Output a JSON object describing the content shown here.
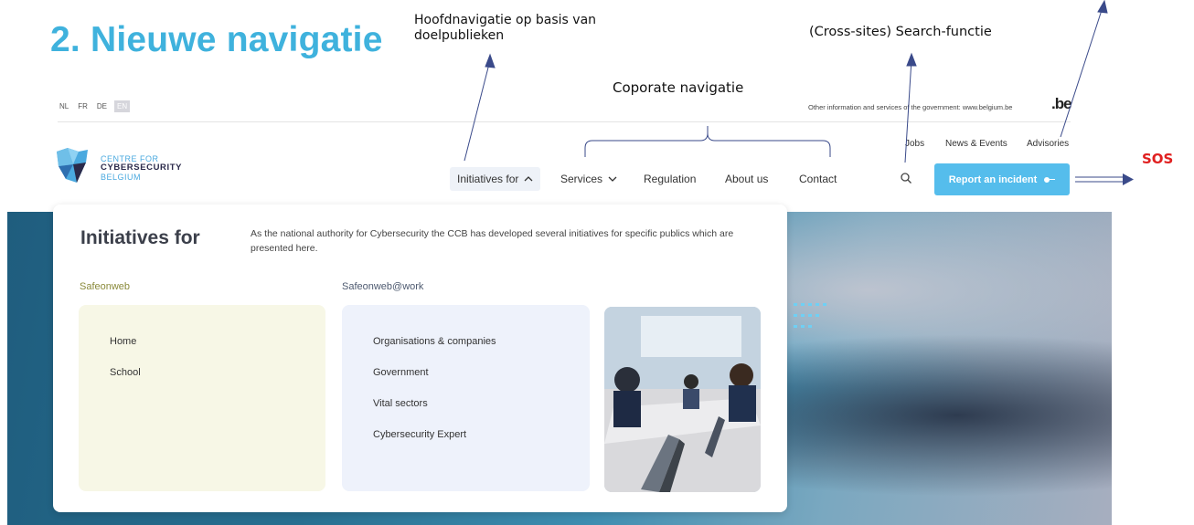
{
  "slide": {
    "title": "2. Nieuwe navigatie",
    "annotations": {
      "hoofdnavigatie": "Hoofdnavigatie op basis van doelpublieken",
      "corporate": "Coporate navigatie",
      "search": "(Cross-sites) Search-functie",
      "sos": "SOS"
    },
    "colors": {
      "title": "#3fb2dd",
      "sos": "#e02020",
      "arrow": "#3a4a8a"
    }
  },
  "site": {
    "languages": [
      "NL",
      "FR",
      "DE",
      "EN"
    ],
    "active_language": "EN",
    "gov_info": "Other information and services of the government: www.belgium.be",
    "be_logo": ".be",
    "logo": {
      "line1": "CENTRE FOR",
      "line2": "CYBERSECURITY",
      "line3": "BELGIUM"
    },
    "secondary_nav": [
      "Jobs",
      "News & Events",
      "Advisories"
    ],
    "main_nav": [
      {
        "label": "Initiatives for",
        "icon": "chevron-up-icon",
        "active": true
      },
      {
        "label": "Services",
        "icon": "chevron-down-icon",
        "active": false
      },
      {
        "label": "Regulation"
      },
      {
        "label": "About us"
      },
      {
        "label": "Contact"
      }
    ],
    "report_button": "Report an incident",
    "accent": "#55bdec"
  },
  "dropdown": {
    "title": "Initiatives for",
    "description": "As the national authority for Cybersecurity the CCB has developed several initiatives for specific publics which are presented here.",
    "columns": [
      {
        "heading": "Safeonweb",
        "items": [
          "Home",
          "School"
        ]
      },
      {
        "heading": "Safeonweb@work",
        "items": [
          "Organisations & companies",
          "Government",
          "Vital sectors",
          "Cybersecurity Expert"
        ]
      }
    ]
  }
}
